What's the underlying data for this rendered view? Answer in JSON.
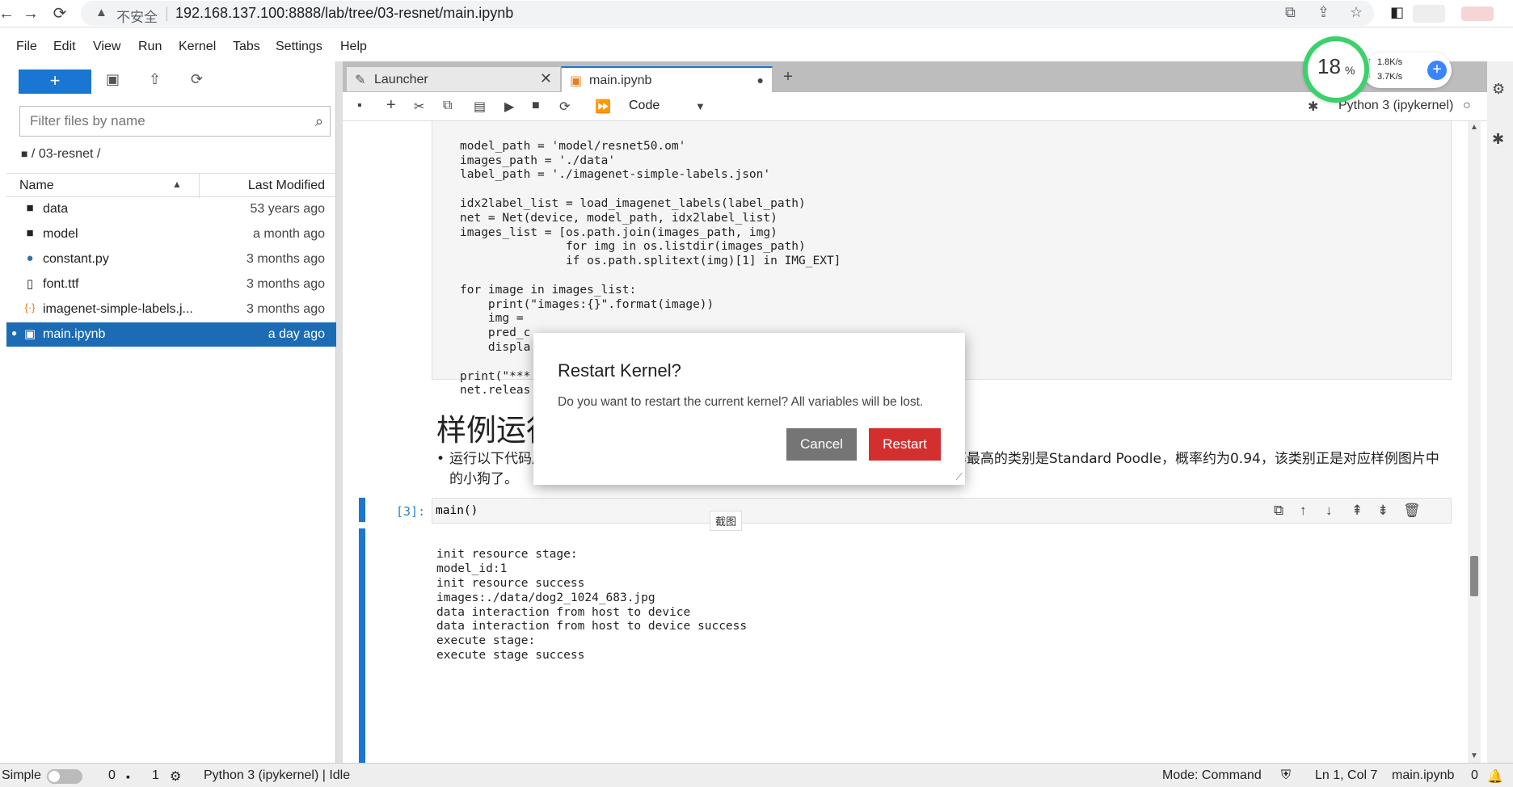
{
  "browser": {
    "security_label": "不安全",
    "url": "192.168.137.100:8888/lab/tree/03-resnet/main.ipynb"
  },
  "menubar": [
    "File",
    "Edit",
    "View",
    "Run",
    "Kernel",
    "Tabs",
    "Settings",
    "Help"
  ],
  "network_widget": {
    "percent": "18",
    "percent_sign": "%",
    "upload": "1.8K/s",
    "download": "3.7K/s"
  },
  "filebrowser": {
    "filter_placeholder": "Filter files by name",
    "breadcrumb": "/ 03-resnet /",
    "col_name": "Name",
    "col_modified": "Last Modified",
    "files": [
      {
        "name": "data",
        "modified": "53 years ago",
        "icon": "folder-icon"
      },
      {
        "name": "model",
        "modified": "a month ago",
        "icon": "folder-icon"
      },
      {
        "name": "constant.py",
        "modified": "3 months ago",
        "icon": "python-icon"
      },
      {
        "name": "font.ttf",
        "modified": "3 months ago",
        "icon": "file-icon"
      },
      {
        "name": "imagenet-simple-labels.j...",
        "modified": "3 months ago",
        "icon": "json-icon"
      },
      {
        "name": "main.ipynb",
        "modified": "a day ago",
        "icon": "notebook-icon",
        "selected": true
      }
    ]
  },
  "tabs": [
    {
      "label": "Launcher",
      "active": false
    },
    {
      "label": "main.ipynb",
      "active": true
    }
  ],
  "notebook_toolbar": {
    "cell_type": "Code",
    "kernel_name": "Python 3 (ipykernel)"
  },
  "cells": {
    "cell1_code": [
      "model_path = 'model/resnet50.om'",
      "images_path = './data'",
      "label_path = './imagenet-simple-labels.json'",
      "",
      "idx2label_list = load_imagenet_labels(label_path)",
      "net = Net(device, model_path, idx2label_list)",
      "images_list = [os.path.join(images_path, img)",
      "               for img in os.listdir(images_path)",
      "               if os.path.splitext(img)[1] in IMG_EXT]",
      "",
      "for image in images_list:",
      "    print(\"images:{}\".format(image))",
      "    img =",
      "    pred_c",
      "    displa",
      "",
      "print(\"***",
      "net.releas"
    ],
    "md_heading": "样例运行",
    "md_bullet": "运行以下代码后，我们可以看到在推理结果中，展示了5个类别的推理概率，其中概率最高的类别是Standard Poodle，概率约为0.94，该类别正是对应样例图片中的小狗了。",
    "cell3_prompt": "[3]:",
    "cell3_code": "main()",
    "cell3_output": [
      "init resource stage:",
      "model_id:1",
      "init resource success",
      "images:./data/dog2_1024_683.jpg",
      "data interaction from host to device",
      "data interaction from host to device success",
      "execute stage:",
      "execute stage success"
    ]
  },
  "dialog": {
    "title": "Restart Kernel?",
    "body": "Do you want to restart the current kernel? All variables will be lost.",
    "cancel_label": "Cancel",
    "restart_label": "Restart",
    "restart_color": "#d32f2f"
  },
  "tooltip": "截图",
  "statusbar": {
    "mode_label": "Simple",
    "terminals": "0",
    "kernels": "1",
    "kernel_status": "Python 3 (ipykernel) | Idle",
    "mode": "Mode: Command",
    "position": "Ln 1, Col 7",
    "filename": "main.ipynb",
    "notifications": "0"
  },
  "accent_color": "#1976d2"
}
